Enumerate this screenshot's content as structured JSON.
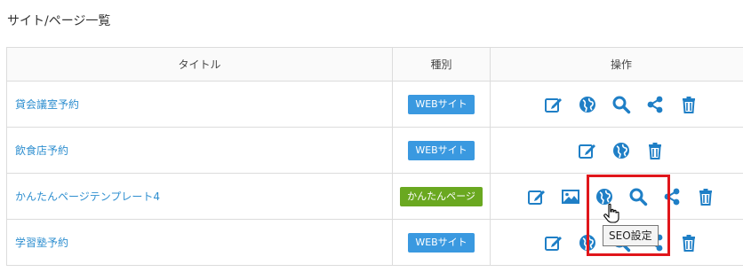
{
  "page": {
    "title": "サイト/ページ一覧"
  },
  "table": {
    "headers": {
      "title": "タイトル",
      "type": "種別",
      "ops": "操作"
    },
    "rows": [
      {
        "title": "貸会議室予約",
        "type": "WEBサイト",
        "type_kind": "web",
        "ops": [
          "edit-icon",
          "globe-icon",
          "search-icon",
          "share-icon",
          "trash-icon"
        ]
      },
      {
        "title": "飲食店予約",
        "type": "WEBサイト",
        "type_kind": "web",
        "ops": [
          "edit-icon",
          "globe-icon",
          "trash-icon"
        ]
      },
      {
        "title": "かんたんページテンプレート4",
        "type": "かんたんページ",
        "type_kind": "easy",
        "ops": [
          "edit-icon",
          "image-icon",
          "globe-icon",
          "search-icon",
          "share-icon",
          "trash-icon"
        ]
      },
      {
        "title": "学習塾予約",
        "type": "WEBサイト",
        "type_kind": "web",
        "ops": [
          "edit-icon",
          "globe-icon",
          "search-icon",
          "share-icon",
          "trash-icon"
        ]
      }
    ]
  },
  "tooltip": {
    "text": "SEO設定"
  },
  "colors": {
    "link": "#2f8fd0",
    "icon": "#1f7fc6",
    "badge_web": "#3a99e0",
    "badge_easy": "#6aa820",
    "highlight": "#e0161b"
  }
}
